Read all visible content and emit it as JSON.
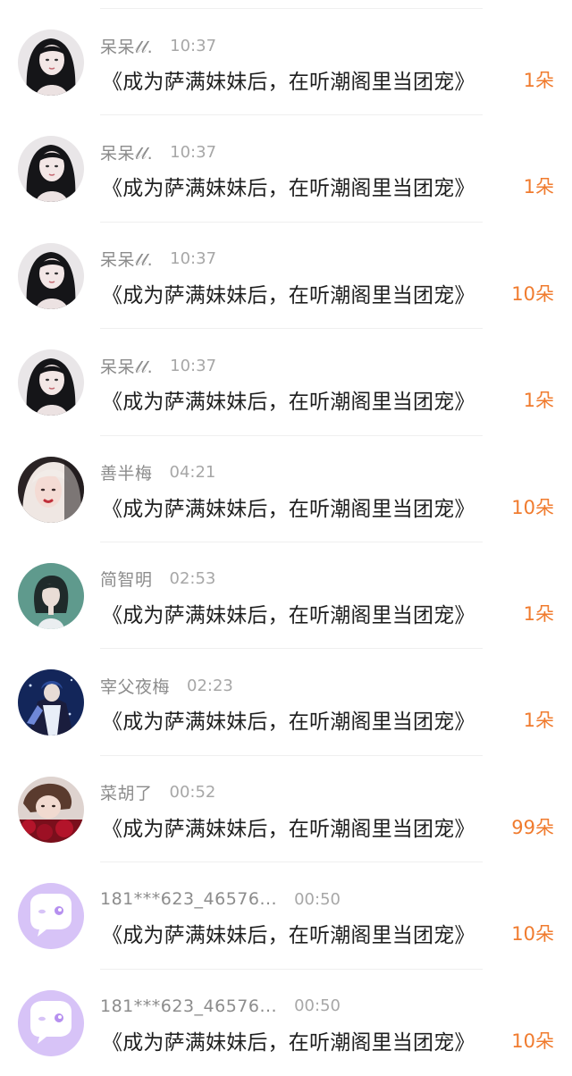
{
  "gift_list": {
    "items": [
      {
        "username": "呆呆𝓁𝓁.",
        "time": "10:37",
        "book_title": "《成为萨满妹妹后，在听潮阁里当团宠》",
        "gift_count": "1朵",
        "avatar_icon": "girl-dark-hair-avatar"
      },
      {
        "username": "呆呆𝓁𝓁.",
        "time": "10:37",
        "book_title": "《成为萨满妹妹后，在听潮阁里当团宠》",
        "gift_count": "1朵",
        "avatar_icon": "girl-dark-hair-avatar"
      },
      {
        "username": "呆呆𝓁𝓁.",
        "time": "10:37",
        "book_title": "《成为萨满妹妹后，在听潮阁里当团宠》",
        "gift_count": "10朵",
        "avatar_icon": "girl-dark-hair-avatar"
      },
      {
        "username": "呆呆𝓁𝓁.",
        "time": "10:37",
        "book_title": "《成为萨满妹妹后，在听潮阁里当团宠》",
        "gift_count": "1朵",
        "avatar_icon": "girl-dark-hair-avatar"
      },
      {
        "username": "善半梅",
        "time": "04:21",
        "book_title": "《成为萨满妹妹后，在听潮阁里当团宠》",
        "gift_count": "10朵",
        "avatar_icon": "girl-white-hair-avatar"
      },
      {
        "username": "简智明",
        "time": "02:53",
        "book_title": "《成为萨满妹妹后，在听潮阁里当团宠》",
        "gift_count": "1朵",
        "avatar_icon": "girl-teal-illustration-avatar"
      },
      {
        "username": "宰父夜梅",
        "time": "02:23",
        "book_title": "《成为萨满妹妹后，在听潮阁里当团宠》",
        "gift_count": "1朵",
        "avatar_icon": "anime-character-blue-avatar"
      },
      {
        "username": "菜胡了",
        "time": "00:52",
        "book_title": "《成为萨满妹妹后，在听潮阁里当团宠》",
        "gift_count": "99朵",
        "avatar_icon": "boy-red-flowers-avatar"
      },
      {
        "username": "181***623_46576...",
        "time": "00:50",
        "book_title": "《成为萨满妹妹后，在听潮阁里当团宠》",
        "gift_count": "10朵",
        "avatar_icon": "default-chat-bubble-avatar"
      },
      {
        "username": "181***623_46576...",
        "time": "00:50",
        "book_title": "《成为萨满妹妹后，在听潮阁里当团宠》",
        "gift_count": "10朵",
        "avatar_icon": "default-chat-bubble-avatar"
      }
    ]
  },
  "colors": {
    "gift_count": "#f07b2e",
    "username": "#8c8c8c",
    "time": "#a7a7a7",
    "title": "#1f1f1f",
    "default_avatar_bg": "#d7c3f7"
  }
}
